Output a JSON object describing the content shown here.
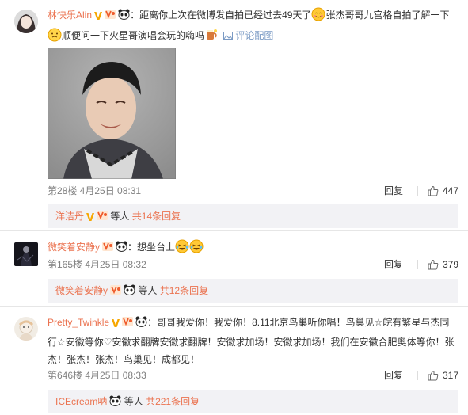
{
  "comments": [
    {
      "user": "林快乐Alin",
      "prefix": "：距离你上次在微博发自拍已经过去49天了",
      "text_line2": "张杰哥哥九宫格自拍了解一下",
      "text_line3": "顺便问一下火星哥演唱会玩的嗨吗",
      "config_label": "评论配图",
      "floor_time": "第28楼 4月25日 08:31",
      "reply_label": "回复",
      "likes": "447",
      "sub": {
        "name": "洋洁丹",
        "suffix": "等人",
        "count": "共14条回复"
      }
    },
    {
      "user": "微笑着安静y",
      "text": "：想坐台上",
      "floor_time": "第165楼 4月25日 08:32",
      "reply_label": "回复",
      "likes": "379",
      "sub": {
        "name": "微笑着安静y",
        "suffix": "等人",
        "count": "共12条回复"
      }
    },
    {
      "user": "Pretty_Twinkle",
      "line1": "：哥哥我爱你！我爱你！8.11北京鸟巢听你唱！鸟巢见☆皖有繁星与杰同",
      "line2": "行☆安徽等你♡安徽求翻牌安徽求翻牌！安徽求加场！安徽求加场！我们在安徽合肥奥体等你！张",
      "line3": "杰！张杰！张杰！鸟巢见！成都见！",
      "floor_time": "第646楼 4月25日 08:33",
      "reply_label": "回复",
      "likes": "317",
      "sub": {
        "name": "ICEcream呐",
        "suffix": "等人",
        "count": "共221条回复"
      }
    }
  ],
  "colors": {
    "username": "#eb7350",
    "meta": "#808080",
    "subbox": "#f2f2f5",
    "vip": "#f7a700"
  },
  "icons": [
    "v-badge",
    "vip-badge",
    "panda-badge",
    "thumb-up-icon",
    "image-icon",
    "smile-emoji",
    "laugh-emoji"
  ]
}
